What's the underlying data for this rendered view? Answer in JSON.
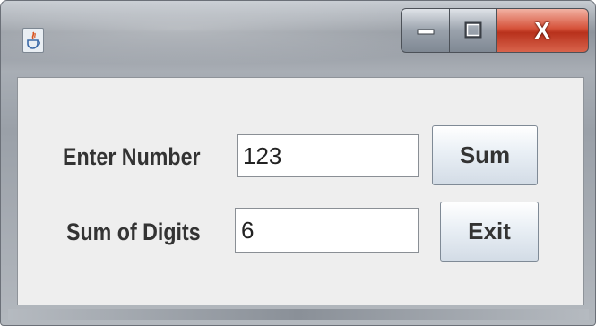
{
  "window": {
    "title": "",
    "icon": "java-coffee-cup-icon",
    "controls": {
      "minimize_icon": "minimize-icon",
      "maximize_icon": "maximize-icon",
      "close_label": "X"
    }
  },
  "form": {
    "enter_number_label": "Enter Number",
    "enter_number_value": "123",
    "sum_button_label": "Sum",
    "sum_of_digits_label": "Sum of Digits",
    "sum_of_digits_value": "6",
    "exit_button_label": "Exit"
  },
  "colors": {
    "close_button": "#d6533b",
    "panel_background": "#eeeeee",
    "button_gradient_bottom": "#d3dce6"
  }
}
